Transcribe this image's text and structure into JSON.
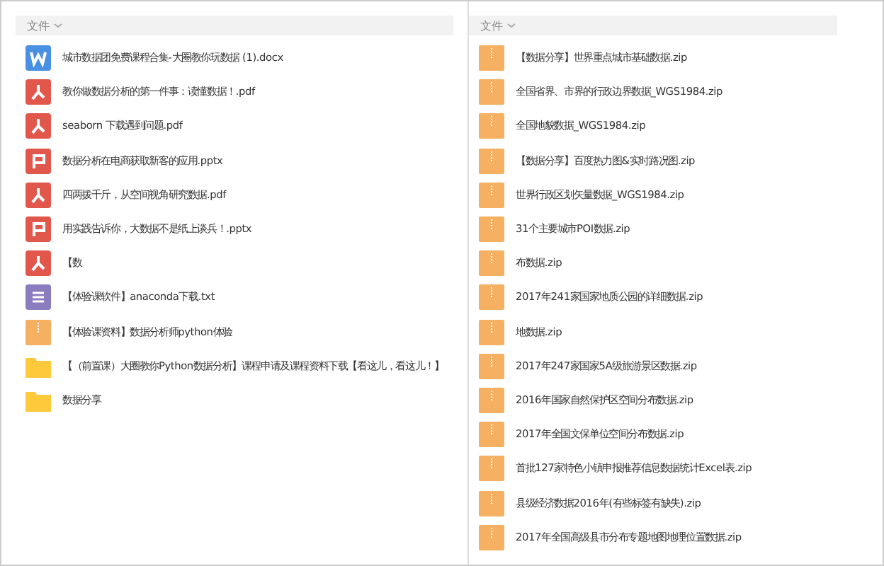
{
  "panels": [
    {
      "header": "文件",
      "files": [
        {
          "kind": "word",
          "name": "城市数据团免费课程合集-大圈教你玩数据 (1).docx"
        },
        {
          "kind": "pdf",
          "name": "教你做数据分析的第一件事：读懂数据！.pdf"
        },
        {
          "kind": "pdf",
          "name": "seaborn 下载遇到问题.pdf"
        },
        {
          "kind": "ppt",
          "name": "数据分析在电商获取新客的应用.pptx"
        },
        {
          "kind": "pdf",
          "name": "四两拨千斤，从空间视角研究数据.pdf"
        },
        {
          "kind": "ppt",
          "name": "用实践告诉你，大数据不是纸上谈兵！.pptx"
        },
        {
          "kind": "pdf",
          "name": "【数"
        },
        {
          "kind": "txt",
          "name": "【体验课软件】anaconda下载.txt"
        },
        {
          "kind": "zip",
          "name": "【体验课资料】数据分析师python体验"
        },
        {
          "kind": "folder",
          "name": "【（前置课）大圈教你Python数据分析】课程申请及课程资料下载【看这儿，看这儿！】"
        },
        {
          "kind": "folder",
          "name": "数据分享"
        }
      ]
    },
    {
      "header": "文件",
      "files": [
        {
          "kind": "zip",
          "name": "【数据分享】世界重点城市基础数据.zip"
        },
        {
          "kind": "zip",
          "name": "全国省界、市界的行政边界数据_WGS1984.zip"
        },
        {
          "kind": "zip",
          "name": "全国地貌数据_WGS1984.zip"
        },
        {
          "kind": "zip",
          "name": "【数据分享】百度热力图&实时路况图.zip"
        },
        {
          "kind": "zip",
          "name": "世界行政区划矢量数据_WGS1984.zip"
        },
        {
          "kind": "zip",
          "name": "31个主要城市POI数据.zip"
        },
        {
          "kind": "zip",
          "name": "布数据.zip"
        },
        {
          "kind": "zip",
          "name": "2017年241家国家地质公园的详细数据.zip"
        },
        {
          "kind": "zip",
          "name": "地数据.zip"
        },
        {
          "kind": "zip",
          "name": "2017年247家国家5A级旅游景区数据.zip"
        },
        {
          "kind": "zip",
          "name": "2016年国家自然保护区空间分布数据.zip"
        },
        {
          "kind": "zip",
          "name": "2017年全国文保单位空间分布数据.zip"
        },
        {
          "kind": "zip",
          "name": "首批127家特色小镇申报推荐信息数据统计Excel表.zip"
        },
        {
          "kind": "zip",
          "name": "县级经济数据2016年(有些标签有缺失).zip"
        },
        {
          "kind": "zip",
          "name": "2017年全国高级县市分布专题地图地理位置数据.zip"
        }
      ]
    }
  ]
}
